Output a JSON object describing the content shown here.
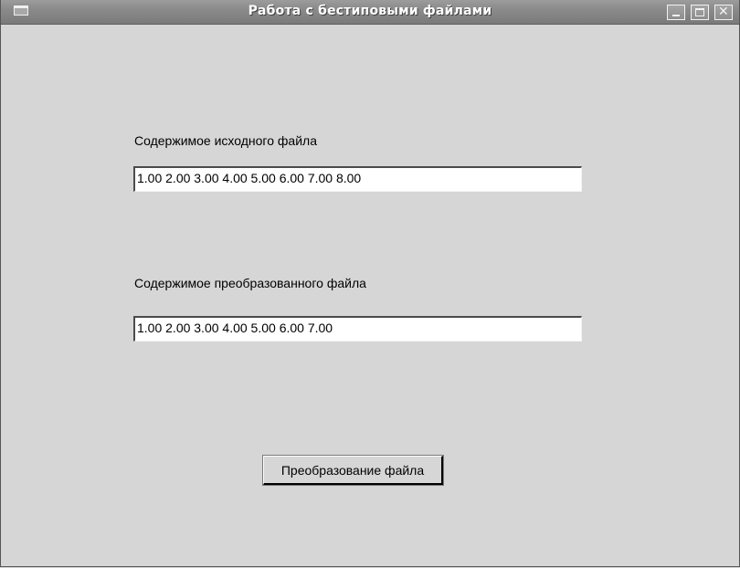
{
  "window": {
    "title": "Работа с бестиповыми файлами"
  },
  "source": {
    "label": "Содержимое исходного файла",
    "value": "1.00 2.00 3.00 4.00 5.00 6.00 7.00 8.00"
  },
  "converted": {
    "label": "Содержимое преобразованного файла",
    "value": "1.00 2.00 3.00 4.00 5.00 6.00 7.00"
  },
  "actions": {
    "convert_label": "Преобразование файла"
  },
  "icons": {
    "window_menu": "window-menu-icon",
    "minimize": "minimize-icon",
    "maximize": "maximize-icon",
    "close": "close-icon"
  }
}
